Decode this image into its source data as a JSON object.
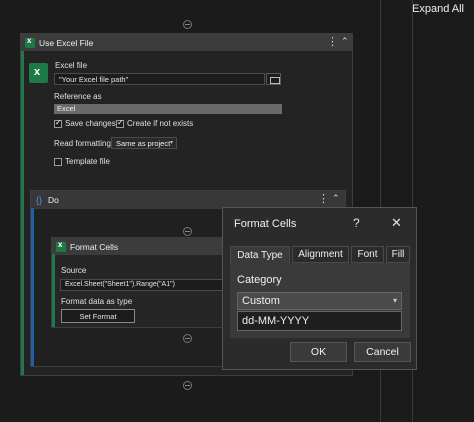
{
  "toolbar": {
    "expand_all_label": "Expand All"
  },
  "use_excel_file": {
    "title": "Use Excel File",
    "excel_file_label": "Excel file",
    "excel_file_value": "\"Your Excel file path\"",
    "reference_as_label": "Reference as",
    "reference_as_value": "Excel",
    "save_changes_label": "Save changes",
    "save_changes_checked": true,
    "create_if_not_exists_label": "Create if not exists",
    "create_if_not_exists_checked": true,
    "read_formatting_label": "Read formatting",
    "read_formatting_value": "Same as project",
    "template_file_label": "Template file",
    "template_file_checked": false
  },
  "do_block": {
    "title": "Do"
  },
  "format_cells_activity": {
    "title": "Format Cells",
    "source_label": "Source",
    "source_value": "Excel.Sheet(\"Sheet1\").Range(\"A1\")",
    "format_data_label": "Format data as type",
    "set_format_label": "Set Format"
  },
  "dialog": {
    "title": "Format Cells",
    "help_label": "?",
    "close_label": "✕",
    "tabs": [
      {
        "label": "Data Type",
        "active": true
      },
      {
        "label": "Alignment",
        "active": false
      },
      {
        "label": "Font",
        "active": false
      },
      {
        "label": "Fill",
        "active": false
      }
    ],
    "category_label": "Category",
    "category_value": "Custom",
    "format_value": "dd-MM-YYYY",
    "ok_label": "OK",
    "cancel_label": "Cancel"
  },
  "colors": {
    "excel_green": "#1e7a4a",
    "do_blue": "#1e5fa8",
    "background": "#1b1b1b"
  },
  "icons": [
    "excel-icon",
    "folder-icon",
    "more-options-icon",
    "collapse-icon",
    "do-sequence-icon",
    "remove-circle-icon",
    "close-icon",
    "help-icon",
    "dropdown-arrow-icon"
  ]
}
